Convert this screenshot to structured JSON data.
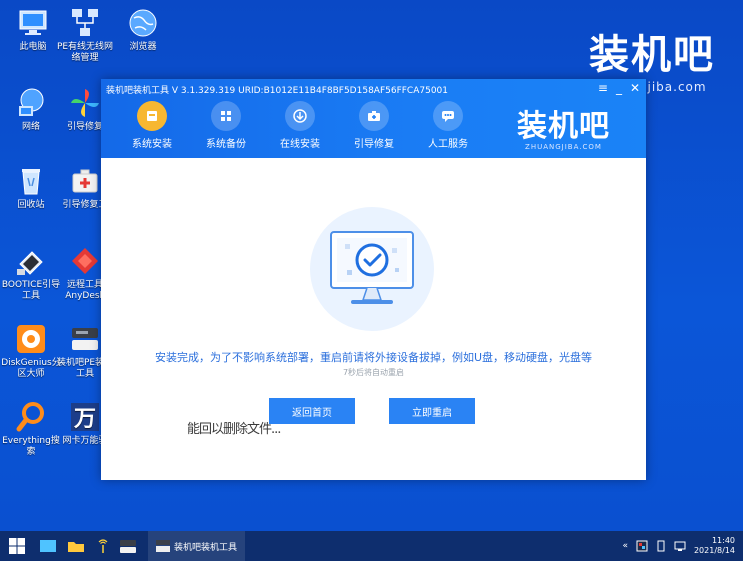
{
  "desktop_icons": [
    {
      "id": "computer",
      "label": "此电脑"
    },
    {
      "id": "pe-network",
      "label": "PE有线无线网络管理"
    },
    {
      "id": "browser",
      "label": "浏览器"
    },
    {
      "id": "network",
      "label": "网络"
    },
    {
      "id": "boot-repair",
      "label": "引导修复"
    },
    {
      "id": "recycle",
      "label": "回收站"
    },
    {
      "id": "boot-copy",
      "label": "引导修复工"
    },
    {
      "id": "bootice",
      "label": "BOOTICE引导工具"
    },
    {
      "id": "anydesk",
      "label": "远程工具AnyDesk"
    },
    {
      "id": "diskgenius",
      "label": "DiskGenius分区大师"
    },
    {
      "id": "pe-tool",
      "label": "装机吧PE装机工具"
    },
    {
      "id": "everything",
      "label": "Everything搜索"
    },
    {
      "id": "wanneng",
      "label": "网卡万能驱"
    }
  ],
  "brand": {
    "big": "装机吧",
    "small": "zhuangjiba.com"
  },
  "window": {
    "title": "装机吧装机工具 V 3.1.329.319 URID:B1012E11B4F8BF5D158AF56FFCA75001",
    "controls": {
      "menu": "≡",
      "minimize": "_",
      "close": "✕"
    },
    "tabs": [
      {
        "label": "系统安装",
        "active": true
      },
      {
        "label": "系统备份",
        "active": false
      },
      {
        "label": "在线安装",
        "active": false
      },
      {
        "label": "引导修复",
        "active": false
      },
      {
        "label": "人工服务",
        "active": false
      }
    ],
    "logo": {
      "big": "装机吧",
      "small": "ZHUANGJIBA.COM"
    },
    "message": "安装完成，为了不影响系统部署，重启前请将外接设备拔掉，例如U盘，移动硬盘，光盘等",
    "countdown": "7秒后将自动重启",
    "buttons": {
      "home": "返回首页",
      "reboot": "立即重启"
    },
    "ghost_text": "能回以删除文件..."
  },
  "taskbar": {
    "app_label": "装机吧装机工具",
    "time": "11:40",
    "date": "2021/8/14",
    "tray_chevron": "«"
  },
  "colors": {
    "desktop": "#0b56d8",
    "window_header": "#1a7df5",
    "accent": "#2a83f4",
    "active_tab": "#f7b731",
    "message": "#2b6fdc"
  }
}
